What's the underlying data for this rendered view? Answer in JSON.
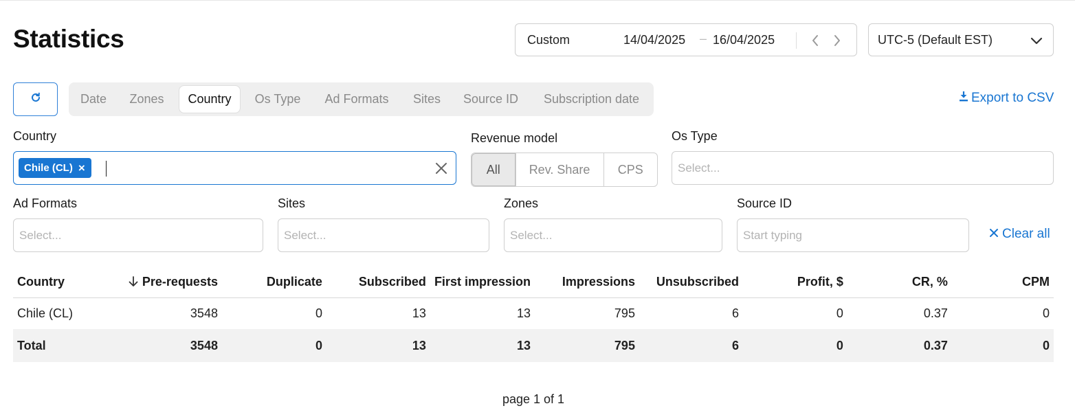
{
  "page": {
    "title": "Statistics"
  },
  "date_range": {
    "preset": "Custom",
    "from": "14/04/2025",
    "separator": "–",
    "to": "16/04/2025"
  },
  "timezone": {
    "value": "UTC-5 (Default EST)"
  },
  "tabs": [
    {
      "label": "Date",
      "active": false
    },
    {
      "label": "Zones",
      "active": false
    },
    {
      "label": "Country",
      "active": true
    },
    {
      "label": "Os Type",
      "active": false
    },
    {
      "label": "Ad Formats",
      "active": false
    },
    {
      "label": "Sites",
      "active": false
    },
    {
      "label": "Source ID",
      "active": false
    },
    {
      "label": "Subscription date",
      "active": false
    }
  ],
  "export_label": "Export to CSV",
  "filters": {
    "country": {
      "label": "Country",
      "chip": "Chile (CL)",
      "chip_remove": "×"
    },
    "revenue_model": {
      "label": "Revenue model",
      "options": [
        "All",
        "Rev. Share",
        "CPS"
      ],
      "selected": "All"
    },
    "os_type": {
      "label": "Os Type",
      "placeholder": "Select..."
    },
    "ad_formats": {
      "label": "Ad Formats",
      "placeholder": "Select..."
    },
    "sites": {
      "label": "Sites",
      "placeholder": "Select..."
    },
    "zones": {
      "label": "Zones",
      "placeholder": "Select..."
    },
    "source_id": {
      "label": "Source ID",
      "placeholder": "Start typing"
    },
    "clear_all": "Clear all"
  },
  "table": {
    "columns": [
      "Country",
      "Pre-requests",
      "Duplicate",
      "Subscribed",
      "First impression",
      "Impressions",
      "Unsubscribed",
      "Profit, $",
      "CR, %",
      "CPM"
    ],
    "sorted_column": "Pre-requests",
    "rows": [
      [
        "Chile (CL)",
        "3548",
        "0",
        "13",
        "13",
        "795",
        "6",
        "0",
        "0.37",
        "0"
      ]
    ],
    "total": [
      "Total",
      "3548",
      "0",
      "13",
      "13",
      "795",
      "6",
      "0",
      "0.37",
      "0"
    ]
  },
  "pagination": {
    "text": "page 1 of 1"
  },
  "colors": {
    "accent": "#1976d2",
    "tab_bg": "#efefef",
    "total_row_bg": "#f2f2f2"
  },
  "icons": {
    "refresh": "refresh-icon",
    "export": "download-icon",
    "clear_all": "close-icon",
    "sort": "arrow-down-icon"
  }
}
